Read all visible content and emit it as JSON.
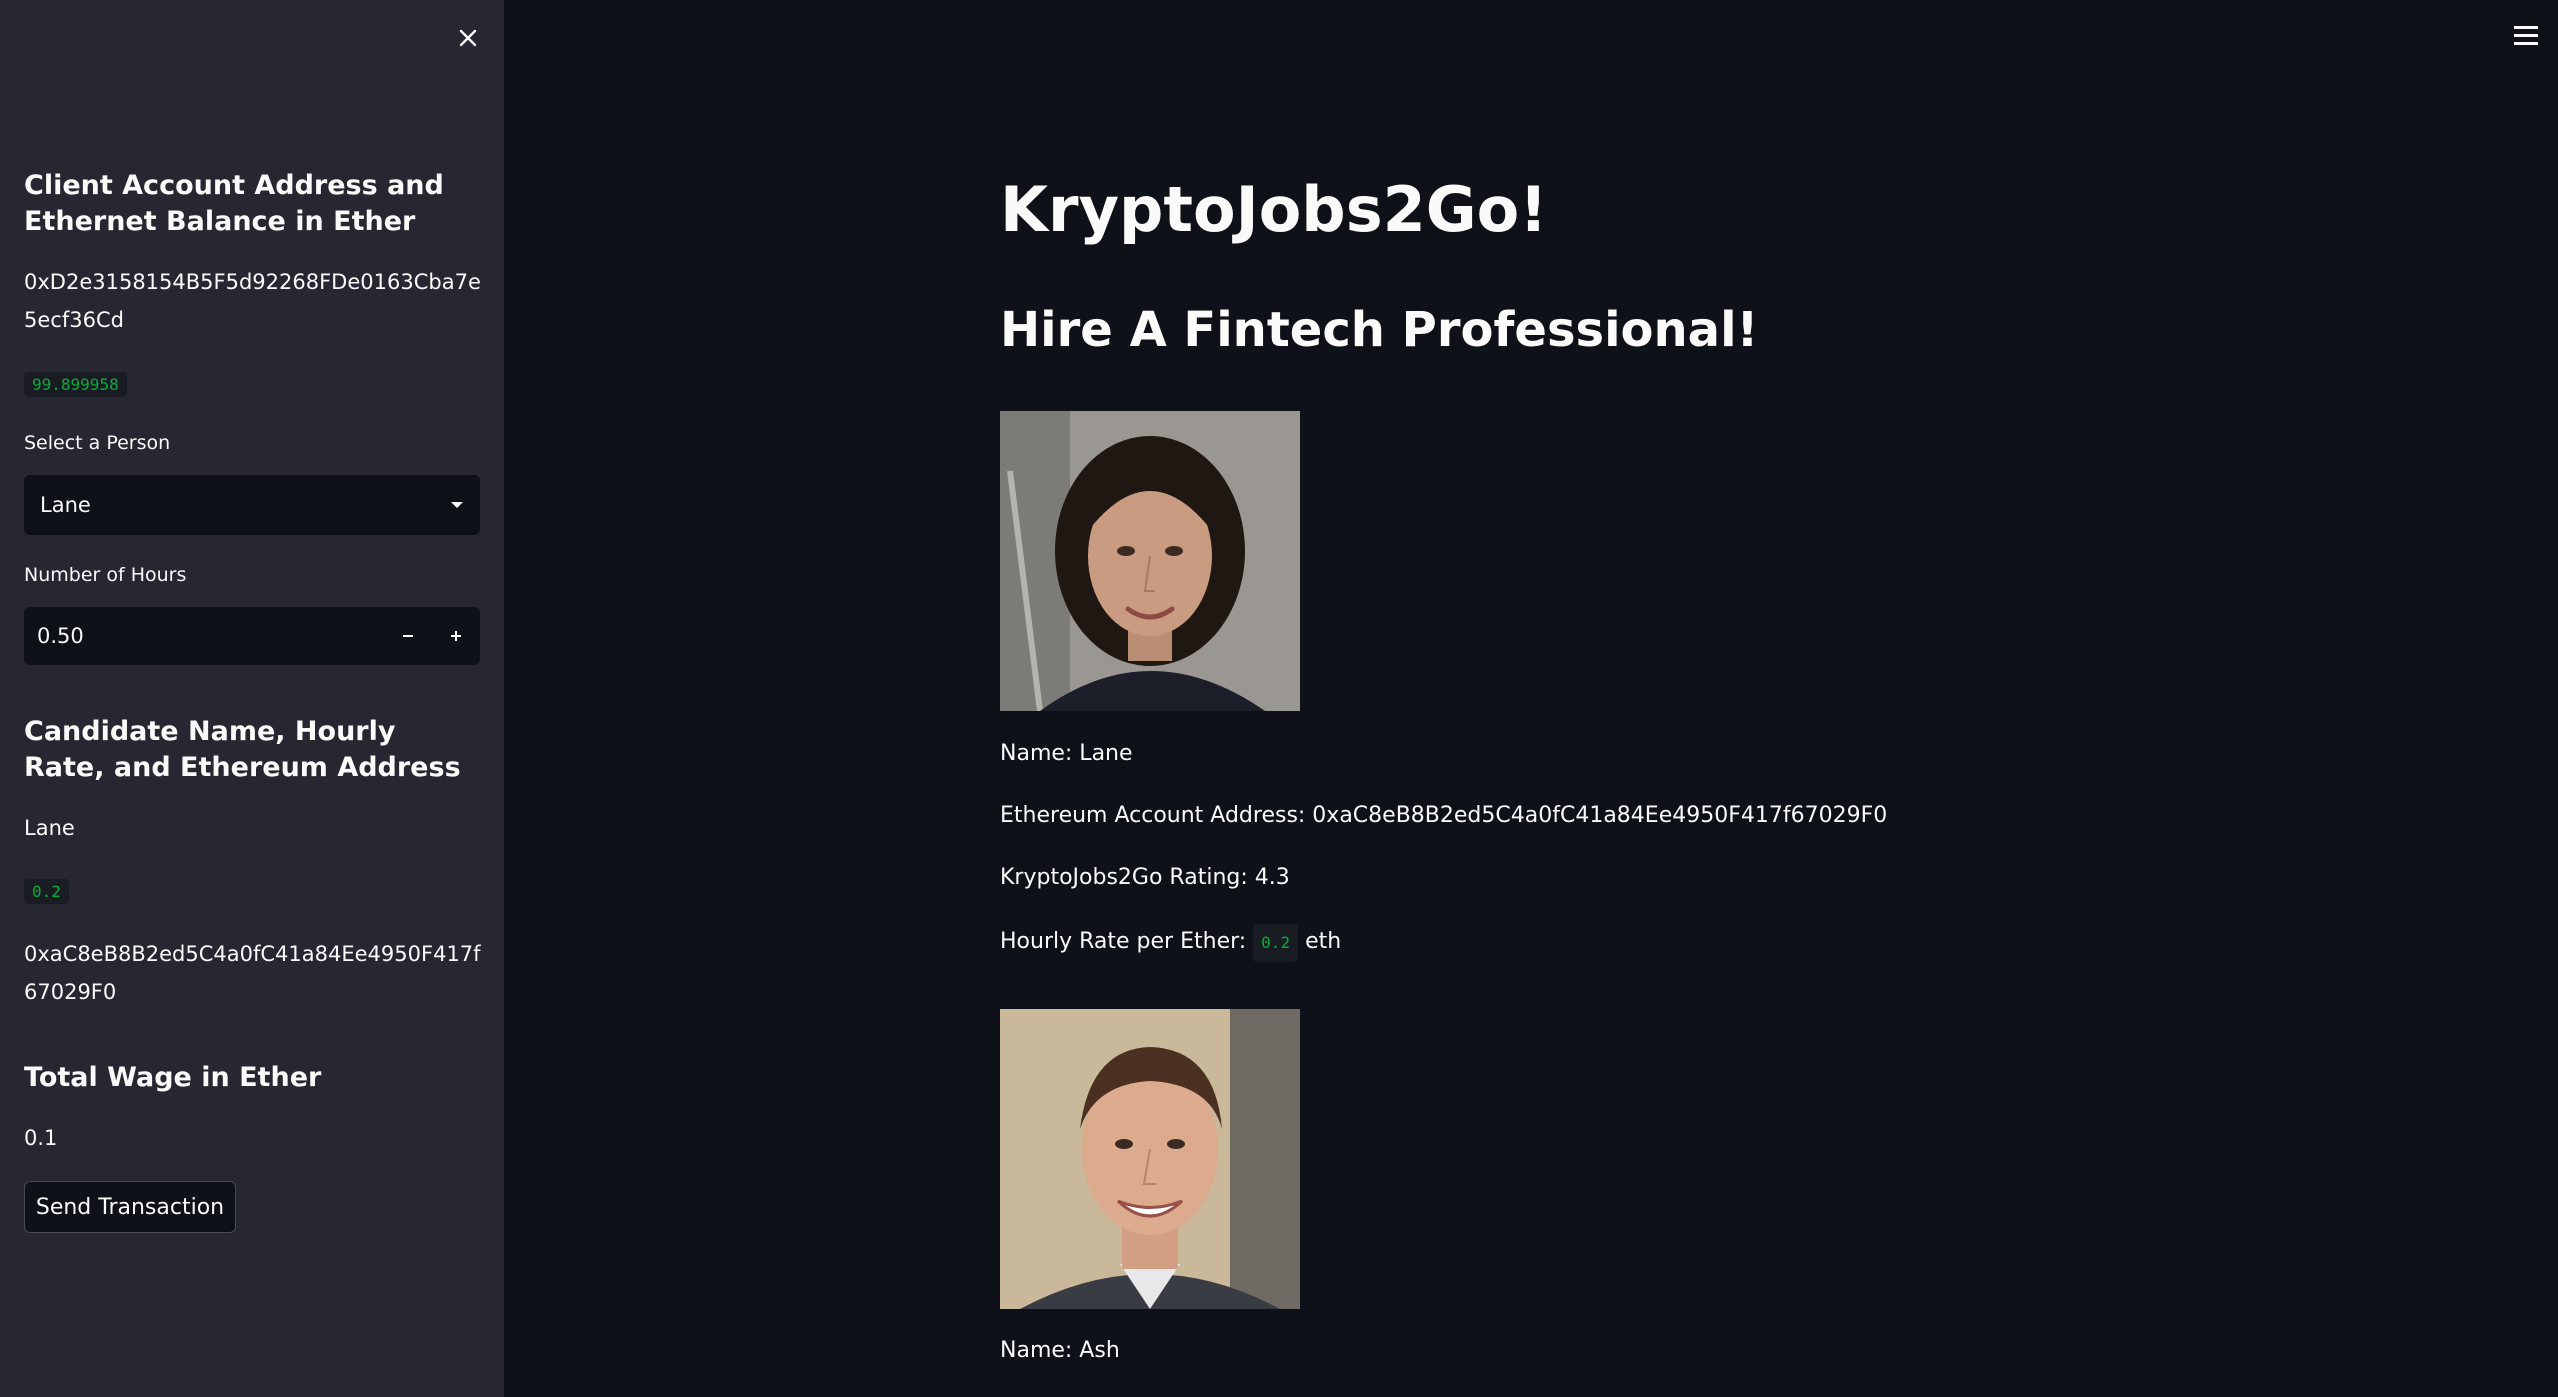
{
  "sidebar": {
    "client_heading": "Client Account Address and Ethernet Balance in Ether",
    "client_address": "0xD2e3158154B5F5d92268FDe0163Cba7e5ecf36Cd",
    "client_balance": "99.899958",
    "select_label": "Select a Person",
    "selected_person": "Lane",
    "hours_label": "Number of Hours",
    "hours_value": "0.50",
    "candidate_heading": "Candidate Name, Hourly Rate, and Ethereum Address",
    "candidate_name": "Lane",
    "candidate_rate": "0.2",
    "candidate_address": "0xaC8eB8B2ed5C4a0fC41a84Ee4950F417f67029F0",
    "wage_heading": "Total Wage in Ether",
    "wage_value": "0.1",
    "send_button": "Send Transaction"
  },
  "main": {
    "title": "KryptoJobs2Go!",
    "subtitle": "Hire A Fintech Professional!",
    "candidates": [
      {
        "name_line": "Name: Lane",
        "address_line": "Ethereum Account Address: 0xaC8eB8B2ed5C4a0fC41a84Ee4950F417f67029F0",
        "rating_line": "KryptoJobs2Go Rating: 4.3",
        "rate_prefix": "Hourly Rate per Ether:",
        "rate_value": "0.2",
        "rate_suffix": "eth"
      },
      {
        "name_line": "Name: Ash"
      }
    ]
  },
  "colors": {
    "sidebar_bg": "#262730",
    "main_bg": "#0e1117",
    "code_green": "#09ab3b"
  },
  "icons": [
    "close-icon",
    "hamburger-menu-icon",
    "chevron-down-icon",
    "minus-icon",
    "plus-icon"
  ]
}
